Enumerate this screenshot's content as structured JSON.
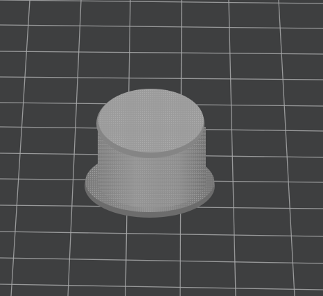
{
  "viewport": {
    "description_type": "slicer-3d-preview",
    "background_color": "#3e3f40",
    "grid_color": "#a9aaab",
    "model": {
      "shape": "cylindrical-cap-with-flange",
      "body_color": "#8e8e8e",
      "top_color": "#9a9a9a",
      "flange_color": "#8b8b8b",
      "texture_color": "#b5b5b5",
      "selected": false
    }
  }
}
